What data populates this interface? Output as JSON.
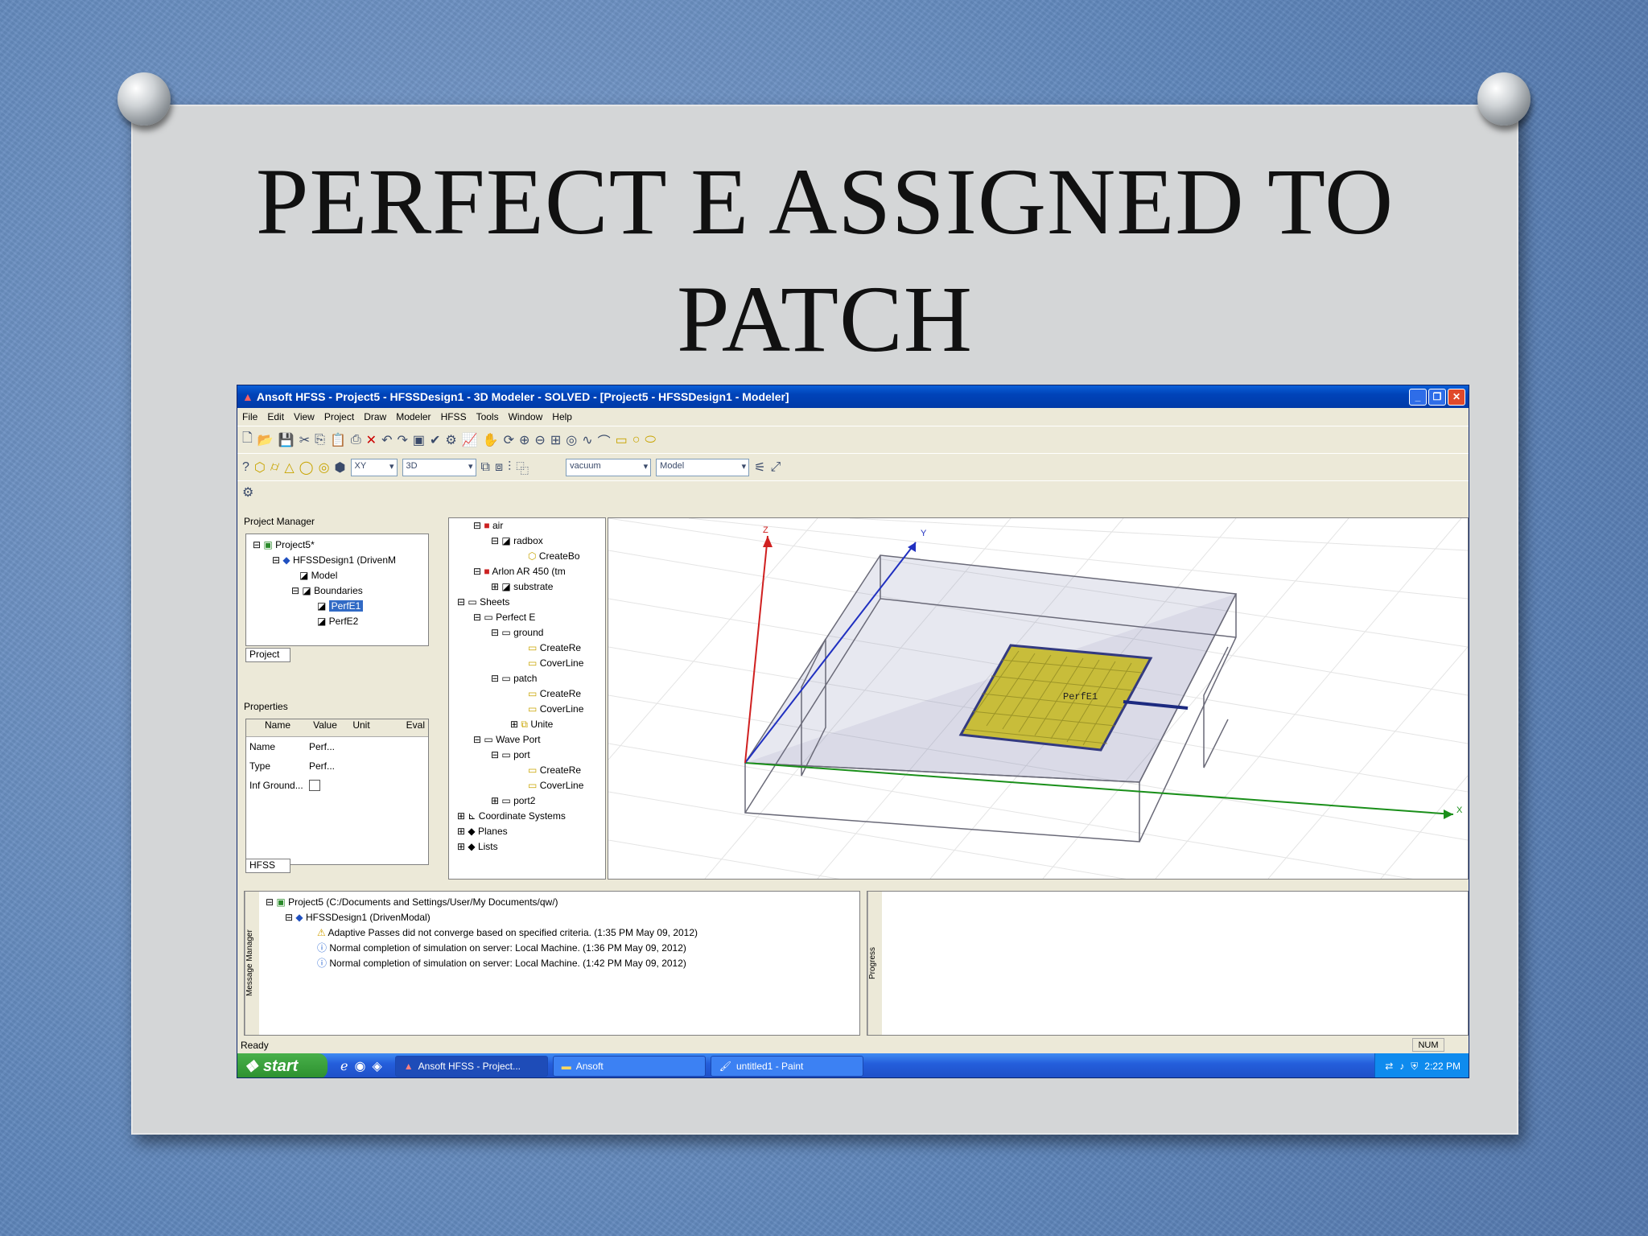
{
  "slide": {
    "title": "PERFECT E ASSIGNED TO PATCH"
  },
  "window": {
    "title": "Ansoft HFSS - Project5 - HFSSDesign1 - 3D Modeler - SOLVED - [Project5 - HFSSDesign1 - Modeler]",
    "menu": [
      "File",
      "Edit",
      "View",
      "Project",
      "Draw",
      "Modeler",
      "HFSS",
      "Tools",
      "Window",
      "Help"
    ]
  },
  "toolbar": {
    "plane": "XY",
    "mode": "3D",
    "material": "vacuum",
    "model": "Model"
  },
  "project_manager": {
    "header": "Project Manager",
    "tab": "Project",
    "items": [
      "Project5*",
      "HFSSDesign1 (DrivenM",
      "Model",
      "Boundaries",
      "PerfE1",
      "PerfE2"
    ]
  },
  "properties": {
    "header": "Properties",
    "tab": "HFSS",
    "columns": [
      "Name",
      "Value",
      "Unit",
      "Eval"
    ],
    "rows": [
      [
        "Name",
        "Perf..."
      ],
      [
        "Type",
        "Perf..."
      ],
      [
        "Inf Ground...",
        ""
      ]
    ]
  },
  "model_tree": [
    "air",
    "radbox",
    "CreateBo",
    "Arlon AR 450 (tm",
    "substrate",
    "Sheets",
    "Perfect E",
    "ground",
    "CreateRe",
    "CoverLine",
    "patch",
    "CreateRe",
    "CoverLine",
    "Unite",
    "Wave Port",
    "port",
    "CreateRe",
    "CoverLine",
    "port2",
    "Coordinate Systems",
    "Planes",
    "Lists"
  ],
  "viewport": {
    "patch_label": "PerfE1",
    "axes": {
      "x": "X",
      "y": "Y",
      "z": "Z"
    }
  },
  "messages": {
    "side_label": "Message Manager",
    "lines": [
      "Project5 (C:/Documents and Settings/User/My Documents/qw/)",
      "HFSSDesign1 (DrivenModal)",
      "Adaptive Passes did not converge based on specified criteria. (1:35 PM  May 09, 2012)",
      "Normal completion of simulation on server: Local Machine. (1:36 PM  May 09, 2012)",
      "Normal completion of simulation on server: Local Machine. (1:42 PM  May 09, 2012)"
    ]
  },
  "progress": {
    "side_label": "Progress"
  },
  "status": {
    "text": "Ready",
    "num": "NUM"
  },
  "taskbar": {
    "start": "start",
    "tasks": [
      "Ansoft HFSS - Project...",
      "Ansoft",
      "untitled1 - Paint"
    ],
    "clock": "2:22 PM"
  },
  "colors": {
    "patch": "#c8bd3a",
    "xaxis": "#1a8f1a",
    "yaxis": "#2030c0",
    "zaxis": "#d02020"
  }
}
